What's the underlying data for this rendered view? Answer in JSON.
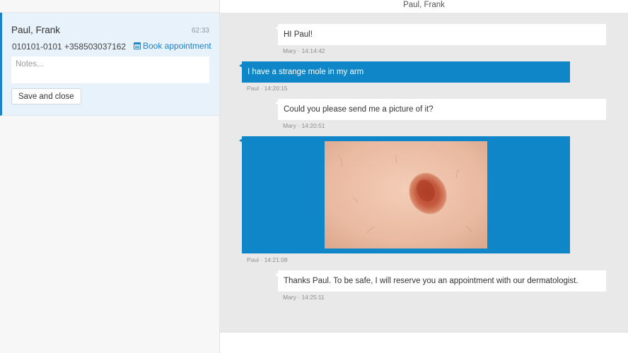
{
  "patient": {
    "name": "Paul, Frank",
    "timer": "62:33",
    "id": "010101-0101",
    "phone": "+358503037162",
    "book_label": "Book appointment",
    "notes_placeholder": "Notes...",
    "save_label": "Save and close"
  },
  "chat": {
    "title": "Paul, Frank",
    "messages": [
      {
        "direction": "in",
        "text": "HI Paul!",
        "meta": "Mary · 14:14:42"
      },
      {
        "direction": "out",
        "text": "I have a strange mole in my arm",
        "meta": "Paul · 14:20:15"
      },
      {
        "direction": "in",
        "text": "Could you please send me a picture of it?",
        "meta": "Mary · 14:20:51"
      },
      {
        "direction": "out",
        "image": "mole-photo",
        "meta": "Paul · 14:21:08"
      },
      {
        "direction": "in",
        "text": "Thanks Paul. To be safe, I will reserve you an appointment with our dermatologist.",
        "meta": "Mary · 14:25:11"
      }
    ]
  },
  "colors": {
    "accent": "#0e86c8",
    "card_bg": "#e8f2fb",
    "chat_bg": "#e9e9e9"
  },
  "icons": {
    "book": "calendar-icon"
  }
}
